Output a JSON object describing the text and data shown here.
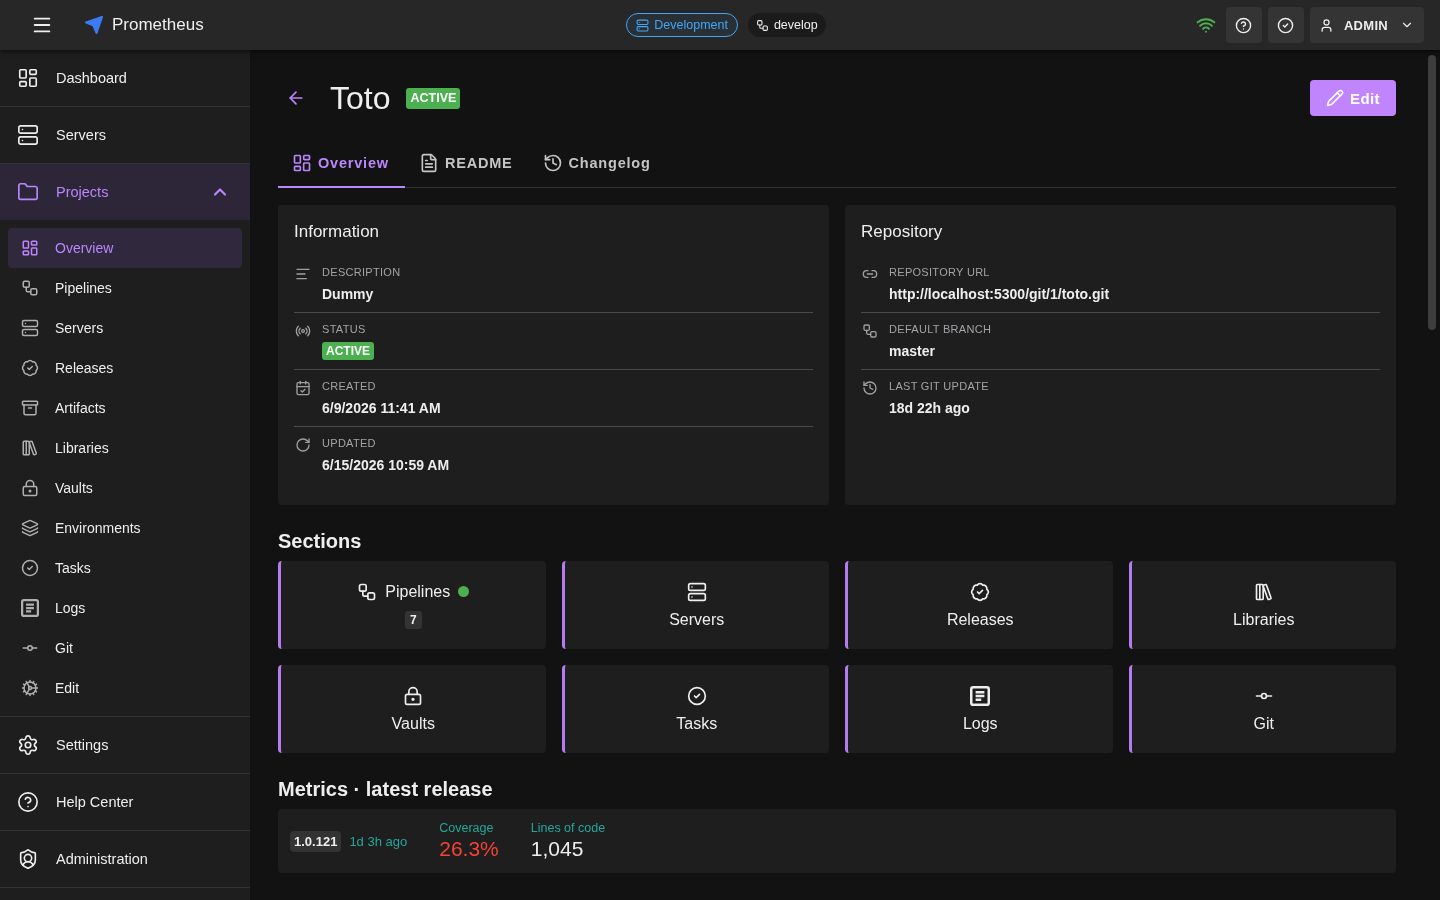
{
  "topbar": {
    "app_name": "Prometheus",
    "environment": "Development",
    "branch": "develop",
    "user": "ADMIN"
  },
  "sidebar": {
    "items": [
      {
        "label": "Dashboard",
        "selected": false
      },
      {
        "label": "Servers",
        "selected": false
      },
      {
        "label": "Projects",
        "selected": true,
        "expanded": true,
        "children": [
          {
            "label": "Overview",
            "selected": true
          },
          {
            "label": "Pipelines",
            "selected": false
          },
          {
            "label": "Servers",
            "selected": false
          },
          {
            "label": "Releases",
            "selected": false
          },
          {
            "label": "Artifacts",
            "selected": false
          },
          {
            "label": "Libraries",
            "selected": false
          },
          {
            "label": "Vaults",
            "selected": false
          },
          {
            "label": "Environments",
            "selected": false
          },
          {
            "label": "Tasks",
            "selected": false
          },
          {
            "label": "Logs",
            "selected": false
          },
          {
            "label": "Git",
            "selected": false
          },
          {
            "label": "Edit",
            "selected": false
          }
        ]
      },
      {
        "label": "Settings",
        "selected": false
      },
      {
        "label": "Help Center",
        "selected": false
      },
      {
        "label": "Administration",
        "selected": false
      }
    ]
  },
  "header": {
    "title": "Toto",
    "status": "ACTIVE",
    "edit_button": "Edit"
  },
  "tabs": [
    {
      "label": "Overview",
      "selected": true
    },
    {
      "label": "README",
      "selected": false
    },
    {
      "label": "Changelog",
      "selected": false
    }
  ],
  "information": {
    "title": "Information",
    "fields": [
      {
        "label": "DESCRIPTION",
        "value": "Dummy",
        "kind": "text"
      },
      {
        "label": "STATUS",
        "value": "ACTIVE",
        "kind": "badge"
      },
      {
        "label": "CREATED",
        "value": "6/9/2026 11:41 AM",
        "kind": "text"
      },
      {
        "label": "UPDATED",
        "value": "6/15/2026 10:59 AM",
        "kind": "text"
      }
    ]
  },
  "repository": {
    "title": "Repository",
    "fields": [
      {
        "label": "REPOSITORY URL",
        "value": "http://localhost:5300/git/1/toto.git",
        "kind": "text"
      },
      {
        "label": "DEFAULT BRANCH",
        "value": "master",
        "kind": "text"
      },
      {
        "label": "LAST GIT UPDATE",
        "value": "18d 22h ago",
        "kind": "text"
      }
    ]
  },
  "sections": {
    "title": "Sections",
    "tiles": [
      {
        "label": "Pipelines",
        "kind": "counted",
        "count": "7",
        "color": "#4caf50"
      },
      {
        "label": "Servers",
        "kind": "plain"
      },
      {
        "label": "Releases",
        "kind": "plain"
      },
      {
        "label": "Libraries",
        "kind": "plain"
      },
      {
        "label": "Vaults",
        "kind": "plain"
      },
      {
        "label": "Tasks",
        "kind": "plain"
      },
      {
        "label": "Logs",
        "kind": "plain"
      },
      {
        "label": "Git",
        "kind": "plain"
      }
    ]
  },
  "metrics": {
    "title": "Metrics · latest release",
    "version": "1.0.121",
    "age": "1d 3h ago",
    "stats": [
      {
        "label": "Coverage",
        "value": "26.3%",
        "color": "#f44336"
      },
      {
        "label": "Lines of code",
        "value": "1,045",
        "color": "#eeeeee"
      }
    ]
  }
}
